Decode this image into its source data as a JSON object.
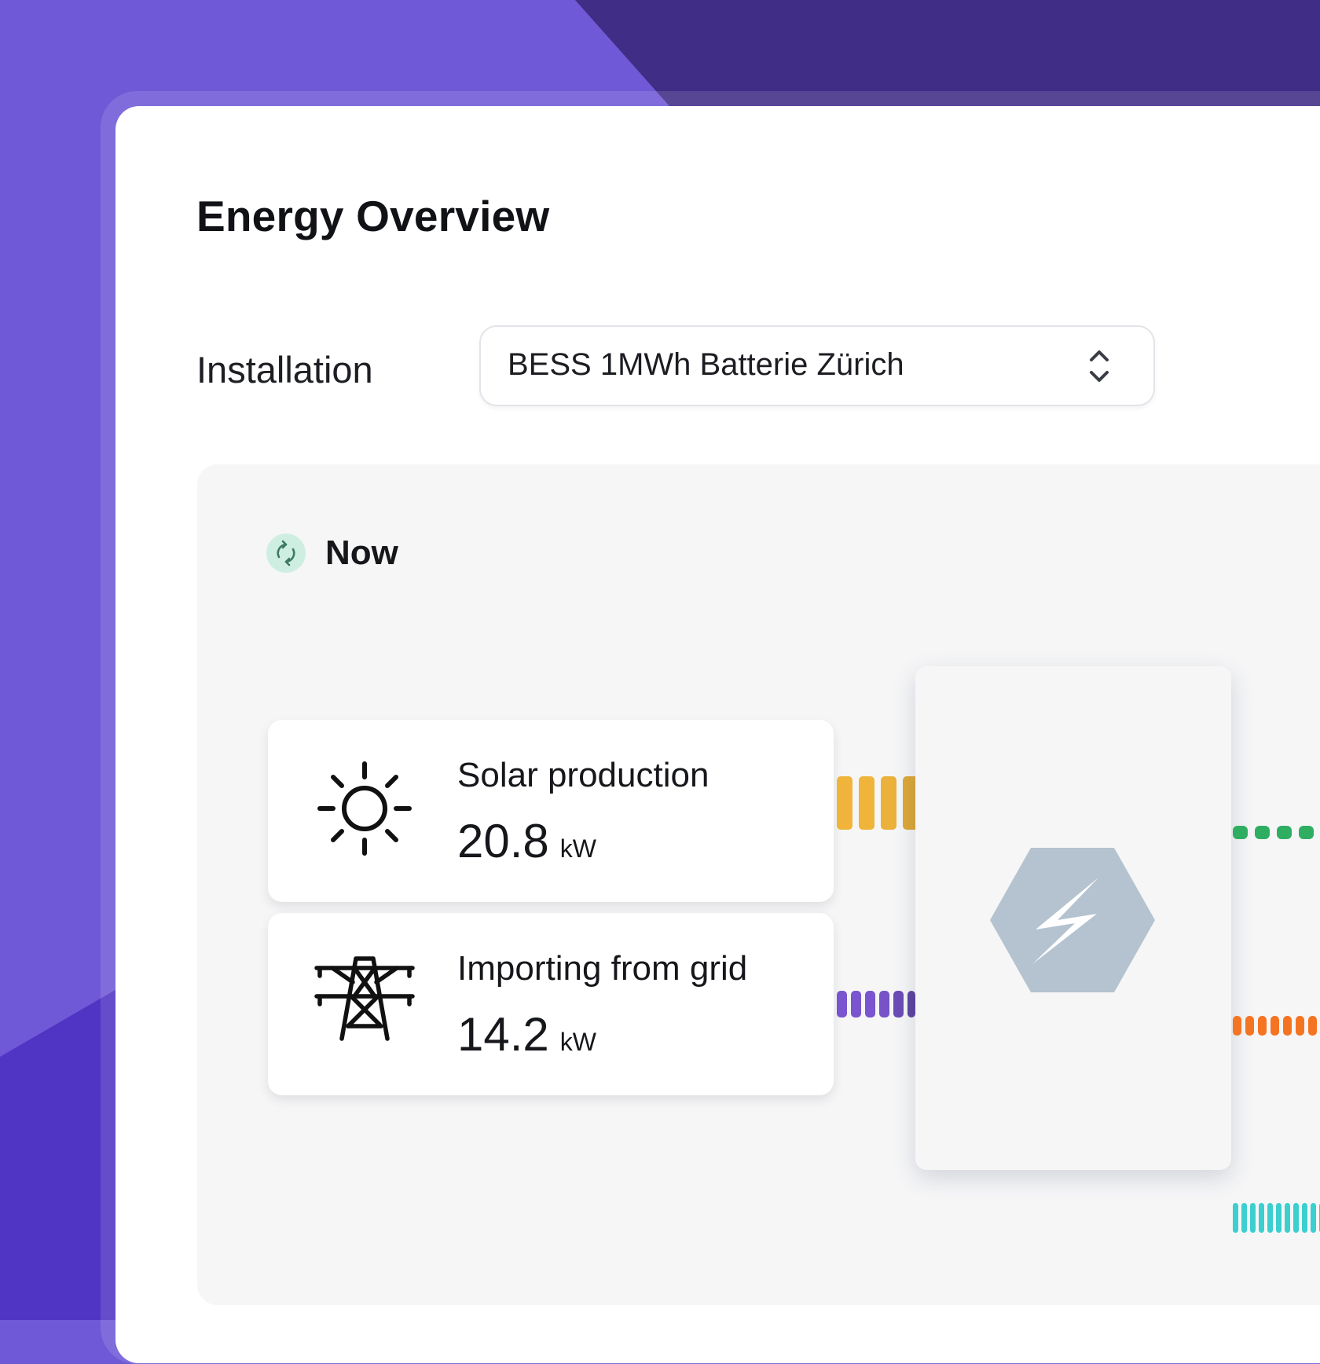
{
  "page": {
    "title": "Energy Overview"
  },
  "installation": {
    "label": "Installation",
    "selected": "BESS 1MWh Batterie Zürich"
  },
  "status": {
    "now_label": "Now"
  },
  "sources": [
    {
      "label": "Solar production",
      "value": "20.8",
      "unit": "kW",
      "icon": "sun-icon",
      "flow_color": "#f0b43a"
    },
    {
      "label": "Importing from grid",
      "value": "14.2",
      "unit": "kW",
      "icon": "power-tower-icon",
      "flow_color": "#7a55cf"
    }
  ],
  "hub": {
    "icon": "lightning-hexagon-icon",
    "color": "#b4c3cf"
  },
  "outputs": [
    {
      "flow_color": "#2fae62"
    },
    {
      "flow_color": "#f57422"
    },
    {
      "flow_color": "#3ccfd0"
    }
  ],
  "colors": {
    "brand": "#6f59d6",
    "brand_dark": "#3f2d86",
    "refresh_bg": "#cfeee2"
  }
}
